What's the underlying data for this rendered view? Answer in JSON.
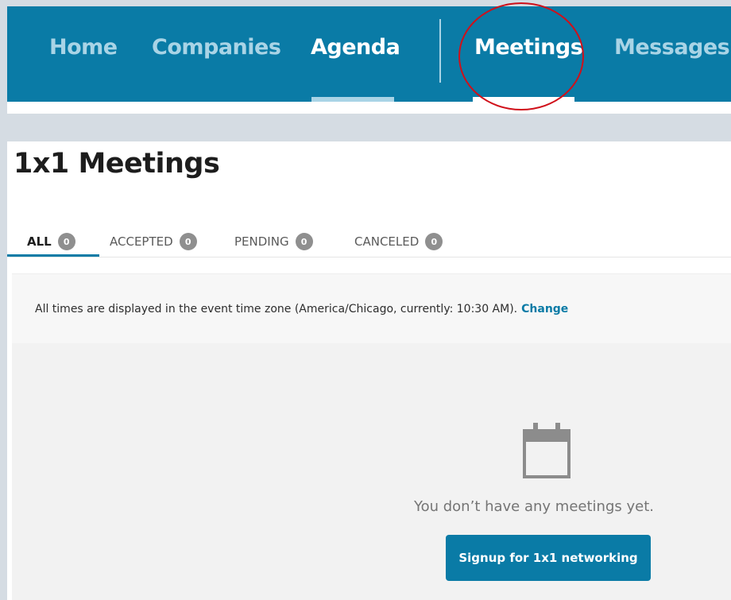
{
  "nav": {
    "items": [
      {
        "label": "Home"
      },
      {
        "label": "Companies"
      },
      {
        "label": "Agenda"
      },
      {
        "label": "Meetings"
      },
      {
        "label": "Messages"
      }
    ]
  },
  "page": {
    "title": "1x1 Meetings",
    "tabs": [
      {
        "label": "ALL",
        "count": "0"
      },
      {
        "label": "ACCEPTED",
        "count": "0"
      },
      {
        "label": "PENDING",
        "count": "0"
      },
      {
        "label": "CANCELED",
        "count": "0"
      }
    ],
    "timezone_notice": "All times are displayed in the event time zone (America/Chicago, currently: 10:30 AM).",
    "timezone_link": "Change",
    "empty_message": "You don’t have any meetings yet.",
    "signup_button": "Signup for 1x1 networking"
  },
  "colors": {
    "brand": "#0a7ba6",
    "highlight_circle": "#d0101a"
  },
  "icons": {
    "empty_state": "calendar-icon"
  }
}
